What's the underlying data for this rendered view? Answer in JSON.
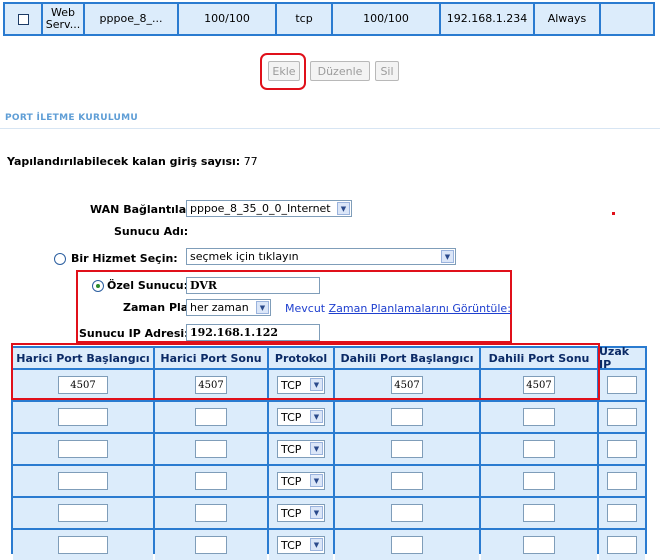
{
  "top_row": {
    "service_name": "Web Serv...",
    "connection": "pppoe_8_...",
    "ext_port": "100/100",
    "protocol": "tcp",
    "int_port": "100/100",
    "ip": "192.168.1.234",
    "schedule": "Always"
  },
  "buttons": {
    "add": "Ekle",
    "edit": "Düzenle",
    "delete": "Sil"
  },
  "section": {
    "title": "PORT İLETME KURULUMU",
    "remaining_label": "Yapılandırılabilecek kalan giriş sayısı:",
    "remaining_value": "77"
  },
  "form": {
    "wan_label": "WAN Bağlantıları",
    "wan_value": "pppoe_8_35_0_0_Internet",
    "server_name_label": "Sunucu Adı:",
    "service_label": "Bir Hizmet Seçin:",
    "service_value": "seçmek için tıklayın",
    "custom_label": "Özel Sunucu:",
    "custom_value": "DVR",
    "schedule_label": "Zaman Planı:",
    "schedule_value": "her zaman",
    "schedule_link_prefix": "Mevcut ",
    "schedule_link": "Zaman Planlamalarını Görüntüle:",
    "ip_label": "Sunucu IP Adresi:",
    "ip_value": "192.168.1.122"
  },
  "table": {
    "headers": [
      "Harici Port Başlangıcı",
      "Harici Port Sonu",
      "Protokol",
      "Dahili Port Başlangıcı",
      "Dahili Port Sonu",
      "Uzak IP"
    ],
    "rows": [
      {
        "ext_start": "4507",
        "ext_end": "4507",
        "protocol": "TCP",
        "int_start": "4507",
        "int_end": "4507",
        "remote": ""
      },
      {
        "ext_start": "",
        "ext_end": "",
        "protocol": "TCP",
        "int_start": "",
        "int_end": "",
        "remote": ""
      },
      {
        "ext_start": "",
        "ext_end": "",
        "protocol": "TCP",
        "int_start": "",
        "int_end": "",
        "remote": ""
      },
      {
        "ext_start": "",
        "ext_end": "",
        "protocol": "TCP",
        "int_start": "",
        "int_end": "",
        "remote": ""
      },
      {
        "ext_start": "",
        "ext_end": "",
        "protocol": "TCP",
        "int_start": "",
        "int_end": "",
        "remote": ""
      },
      {
        "ext_start": "",
        "ext_end": "",
        "protocol": "TCP",
        "int_start": "",
        "int_end": "",
        "remote": ""
      }
    ]
  },
  "icons": {
    "dropdown_arrow": "chevron-down-icon",
    "radio": "radio-icon"
  },
  "colors": {
    "table_border": "#2a7bd0",
    "cell_bg": "#dcecfb",
    "highlight": "#e0101a",
    "section_title": "#5f9ed6",
    "link": "#1e3fcf"
  }
}
